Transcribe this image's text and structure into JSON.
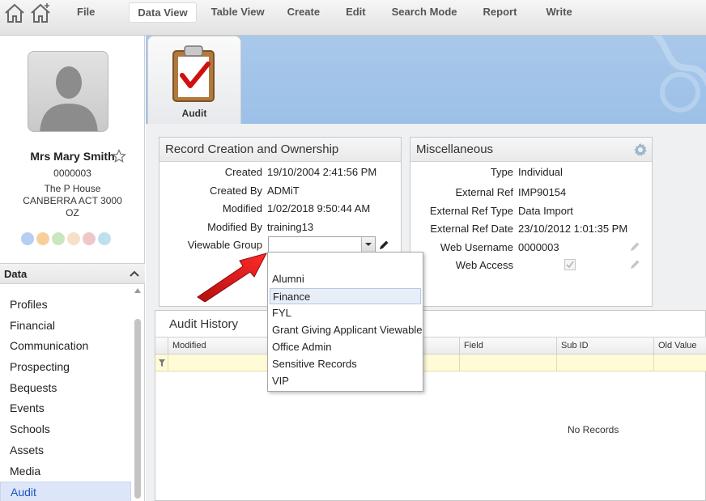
{
  "menu": {
    "items": [
      "File",
      "Data View",
      "Table View",
      "Create",
      "Edit",
      "Search Mode",
      "Report",
      "Write"
    ],
    "active": "Data View"
  },
  "icons": [
    "home-icon",
    "add-home-icon",
    "star-icon",
    "gear-icon",
    "pencil-icon",
    "chevron-up-icon",
    "dropdown-caret-icon",
    "clipboard-check-icon"
  ],
  "profile": {
    "name": "Mrs Mary Smith",
    "id": "0000003",
    "address1": "The P House",
    "address2": "CANBERRA ACT 3000",
    "country": "OZ"
  },
  "sidebar": {
    "header": "Data",
    "items": [
      "Profiles",
      "Financial",
      "Communication",
      "Prospecting",
      "Bequests",
      "Events",
      "Schools",
      "Assets",
      "Media",
      "Audit"
    ],
    "active": "Audit"
  },
  "tab": {
    "label": "Audit"
  },
  "record_creation": {
    "title": "Record Creation and Ownership",
    "fields": [
      {
        "label": "Created",
        "value": "19/10/2004 2:41:56 PM"
      },
      {
        "label": "Created By",
        "value": "ADMiT"
      },
      {
        "label": "Modified",
        "value": "1/02/2018 9:50:44 AM"
      },
      {
        "label": "Modified By",
        "value": "training13"
      }
    ],
    "viewable_group": {
      "label": "Viewable Group",
      "value": ""
    }
  },
  "misc": {
    "title": "Miscellaneous",
    "fields": [
      {
        "label": "Type",
        "value": "Individual"
      },
      {
        "label": "External Ref",
        "value": "IMP90154"
      },
      {
        "label": "External Ref Type",
        "value": "Data Import"
      },
      {
        "label": "External Ref Date",
        "value": "23/10/2012 1:01:35 PM"
      },
      {
        "label": "Web Username",
        "value": "0000003"
      },
      {
        "label": "Web Access",
        "value": ""
      }
    ]
  },
  "dropdown": {
    "options": [
      "",
      "Alumni",
      "Finance",
      "FYL",
      "Grant Giving Applicant Viewable",
      "Office Admin",
      "Sensitive Records",
      "VIP"
    ],
    "highlighted": "Finance"
  },
  "audit_history": {
    "title": "Audit History",
    "columns": [
      "Modified",
      "Field",
      "Sub ID",
      "Old Value"
    ],
    "empty_text": "No Records"
  },
  "colors": {
    "accent": "#1a53c4",
    "banner": "#a9c8ea",
    "filter_row": "#fffbd6",
    "arrow": "#e02020"
  }
}
